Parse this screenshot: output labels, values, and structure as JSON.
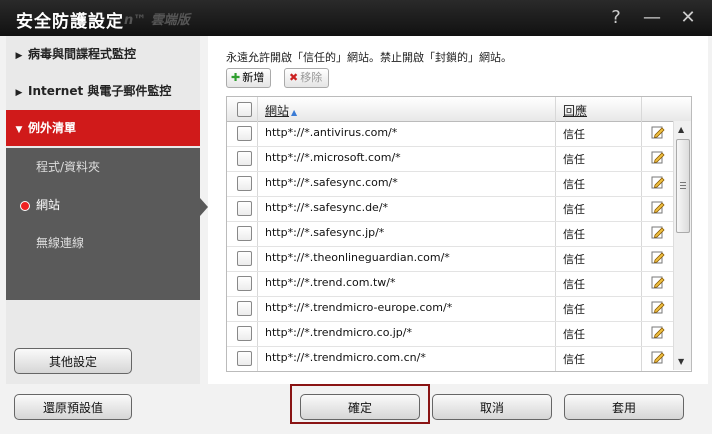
{
  "window": {
    "title": "安全防護設定",
    "brand": "n™ 雲端版",
    "controls": [
      "?",
      "—",
      "✕"
    ]
  },
  "sidebar": {
    "main_items": [
      {
        "label": "病毒與間諜程式監控",
        "state": "collapsed"
      },
      {
        "label": "Internet 與電子郵件監控",
        "state": "collapsed"
      },
      {
        "label": "例外清單",
        "state": "expanded"
      }
    ],
    "sub_items": [
      {
        "label": "程式/資料夾",
        "active": false
      },
      {
        "label": "網站",
        "active": true
      },
      {
        "label": "無線連線",
        "active": false
      }
    ],
    "other_settings_label": "其他設定"
  },
  "main": {
    "description": "永遠允許開啟「信任的」網站。禁止開啟「封鎖的」網站。",
    "add_label": "新增",
    "remove_label": "移除",
    "table": {
      "columns": [
        "網站",
        "回應"
      ],
      "rows": [
        {
          "url": "http*://*.antivirus.com/*",
          "response": "信任"
        },
        {
          "url": "http*://*.microsoft.com/*",
          "response": "信任"
        },
        {
          "url": "http*://*.safesync.com/*",
          "response": "信任"
        },
        {
          "url": "http*://*.safesync.de/*",
          "response": "信任"
        },
        {
          "url": "http*://*.safesync.jp/*",
          "response": "信任"
        },
        {
          "url": "http*://*.theonlineguardian.com/*",
          "response": "信任"
        },
        {
          "url": "http*://*.trend.com.tw/*",
          "response": "信任"
        },
        {
          "url": "http*://*.trendmicro-europe.com/*",
          "response": "信任"
        },
        {
          "url": "http*://*.trendmicro.co.jp/*",
          "response": "信任"
        },
        {
          "url": "http*://*.trendmicro.com.cn/*",
          "response": "信任"
        }
      ]
    }
  },
  "footer": {
    "restore_defaults_label": "還原預設值",
    "ok_label": "確定",
    "cancel_label": "取消",
    "apply_label": "套用"
  },
  "colors": {
    "title_bar": "#111111",
    "active_nav": "#d01a1a",
    "sub_nav_bg": "#5a5a5a",
    "highlight_outline": "#8a1414",
    "add_icon": "#2e9e2e",
    "remove_icon": "#cc2222"
  },
  "icons": {
    "add": "plus-icon",
    "remove": "x-icon",
    "edit": "pencil-icon",
    "sort": "sort-ascending-icon",
    "active_item": "red-dot-icon"
  }
}
